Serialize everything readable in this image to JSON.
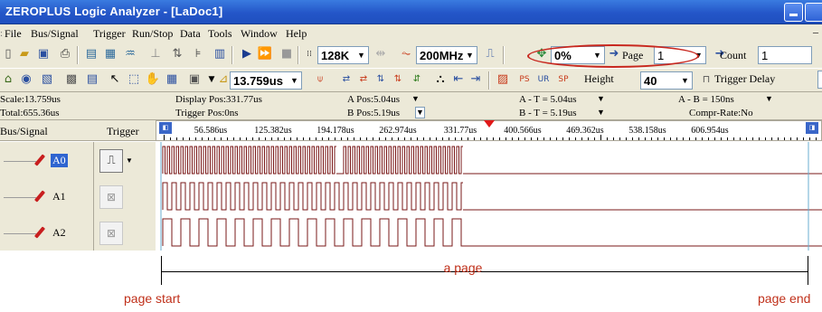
{
  "window": {
    "title": "ZEROPLUS Logic Analyzer - [LaDoc1]"
  },
  "menu": [
    "File",
    "Bus/Signal",
    "Trigger",
    "Run/Stop",
    "Data",
    "Tools",
    "Window",
    "Help"
  ],
  "toolbar": {
    "memory_depth": "128K",
    "sample_rate": "200MHz",
    "zoom_percent": "0%",
    "page_label": "Page",
    "page_value": "1",
    "count_label": "Count",
    "count_value": "1",
    "scale_value": "13.759us",
    "height_label": "Height",
    "height_value": "40",
    "trigger_delay_label": "Trigger Delay"
  },
  "info": {
    "scale": "Scale:13.759us",
    "total": "Total:655.36us",
    "display_pos": "Display Pos:331.77us",
    "trigger_pos": "Trigger Pos:0ns",
    "a_pos": "A Pos:5.04us",
    "b_pos": "B Pos:5.19us",
    "a_minus_t": "A - T = 5.04us",
    "b_minus_t": "B - T = 5.19us",
    "a_minus_b": "A - B = 150ns",
    "compr_rate": "Compr-Rate:No"
  },
  "columns": {
    "bus_signal": "Bus/Signal",
    "trigger": "Trigger"
  },
  "ruler": {
    "ticks": [
      "56.586us",
      "125.382us",
      "194.178us",
      "262.974us",
      "331.77us",
      "400.566us",
      "469.362us",
      "538.158us",
      "606.954us"
    ]
  },
  "signals": [
    {
      "name": "A0",
      "selected": true,
      "trigger": "edge"
    },
    {
      "name": "A1",
      "selected": false,
      "trigger": "none"
    },
    {
      "name": "A2",
      "selected": false,
      "trigger": "none"
    }
  ],
  "annotations": {
    "a_page": "a page",
    "page_start": "page start",
    "page_end": "page end"
  },
  "colors": {
    "titlebar": "#2456c8",
    "waveform": "#7a1818",
    "annotation": "#c0301a",
    "highlight_oval": "#c8281f"
  }
}
